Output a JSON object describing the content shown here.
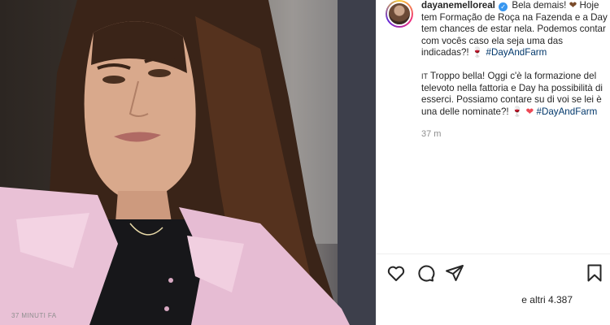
{
  "post": {
    "username": "dayanemelloreal",
    "verified_icon": "verified-badge-icon",
    "caption_pt_line1_tail": "Bela demais! ",
    "caption_pt_heart": "❤",
    "caption_pt_body": "Hoje tem Formação de Roça na Fazenda e a Day tem chances de estar nela. Podemos contar com vocês caso ela seja uma das indicadas?! ",
    "caption_pt_emoji": "🍷",
    "caption_pt_hashtag": "#DayAndFarm",
    "caption_it_flag": "IT",
    "caption_it_body": "Troppo bella! Oggi c'è la formazione del televoto nella fattoria e Day ha possibilità di esserci. Possiamo contare su di voi se lei è una delle nominate?! ",
    "caption_it_emoji": "🍷",
    "caption_it_heart": "❤",
    "caption_it_hashtag": "#DayAndFarm",
    "time_ago": "37 m"
  },
  "actions": {
    "like_icon": "heart-icon",
    "comment_icon": "comment-icon",
    "share_icon": "paper-plane-icon",
    "save_icon": "bookmark-icon"
  },
  "likes_text": "e altri 4.387",
  "posted_ago": "37 MINUTI FA",
  "colors": {
    "hashtag": "#00376b",
    "verified": "#3897f0",
    "muted": "#8e8e8e",
    "heart": "#ed4956"
  }
}
